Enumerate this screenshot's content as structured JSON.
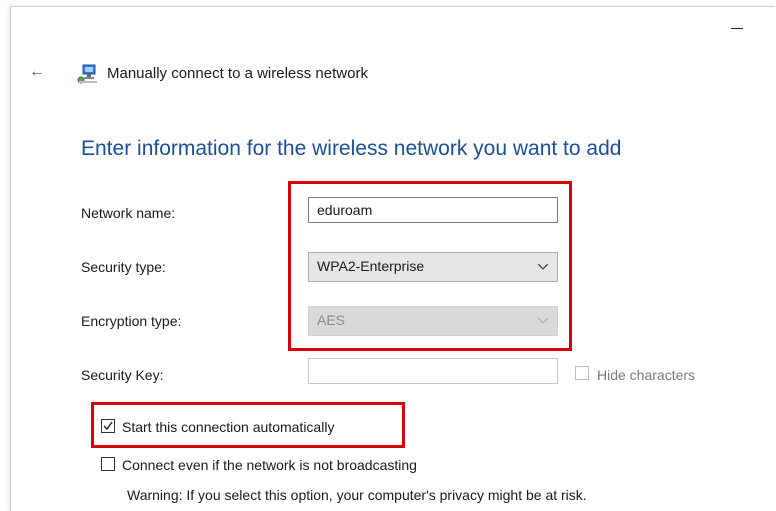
{
  "window": {
    "title": "Manually connect to a wireless network",
    "minimize_glyph": "—",
    "back_glyph": "←"
  },
  "heading": "Enter information for the wireless network you want to add",
  "form": {
    "network_name_label": "Network name:",
    "network_name_value": "eduroam",
    "security_type_label": "Security type:",
    "security_type_value": "WPA2-Enterprise",
    "encryption_type_label": "Encryption type:",
    "encryption_type_value": "AES",
    "security_key_label": "Security Key:",
    "security_key_value": "",
    "hide_characters_label": "Hide characters"
  },
  "options": {
    "start_auto_label": "Start this connection automatically",
    "start_auto_checked": true,
    "connect_nonbroadcast_label": "Connect even if the network is not broadcasting",
    "connect_nonbroadcast_checked": false,
    "warning_text": "Warning: If you select this option, your computer's privacy might be at risk."
  },
  "icons": {
    "back": "back-arrow-icon",
    "network": "wireless-network-icon",
    "dropdown": "chevron-down-icon",
    "check": "checkmark-icon"
  },
  "colors": {
    "heading": "#1a4f9c",
    "highlight_box": "#d9000b"
  }
}
